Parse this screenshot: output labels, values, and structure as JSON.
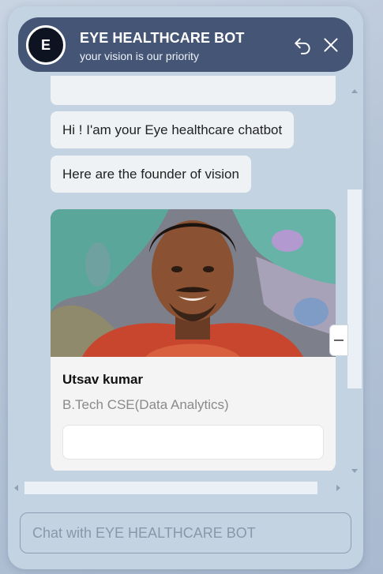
{
  "header": {
    "avatar_letter": "E",
    "title": "EYE HEALTHCARE BOT",
    "subtitle": "your vision is our priority",
    "restart_icon": "restart-icon",
    "close_icon": "close-icon"
  },
  "messages": [
    {
      "text": ""
    },
    {
      "text": "Hi ! I'am your Eye healthcare chatbot"
    },
    {
      "text": "Here are the founder of vision"
    }
  ],
  "card": {
    "name": "Utsav kumar",
    "description": "B.Tech CSE(Data Analytics)",
    "button_label": ""
  },
  "input": {
    "placeholder": "Chat with EYE HEALTHCARE BOT",
    "value": ""
  },
  "colors": {
    "header_bg": "#445576",
    "widget_bg": "#c3d3e2",
    "bubble_bg": "#eef2f5"
  }
}
